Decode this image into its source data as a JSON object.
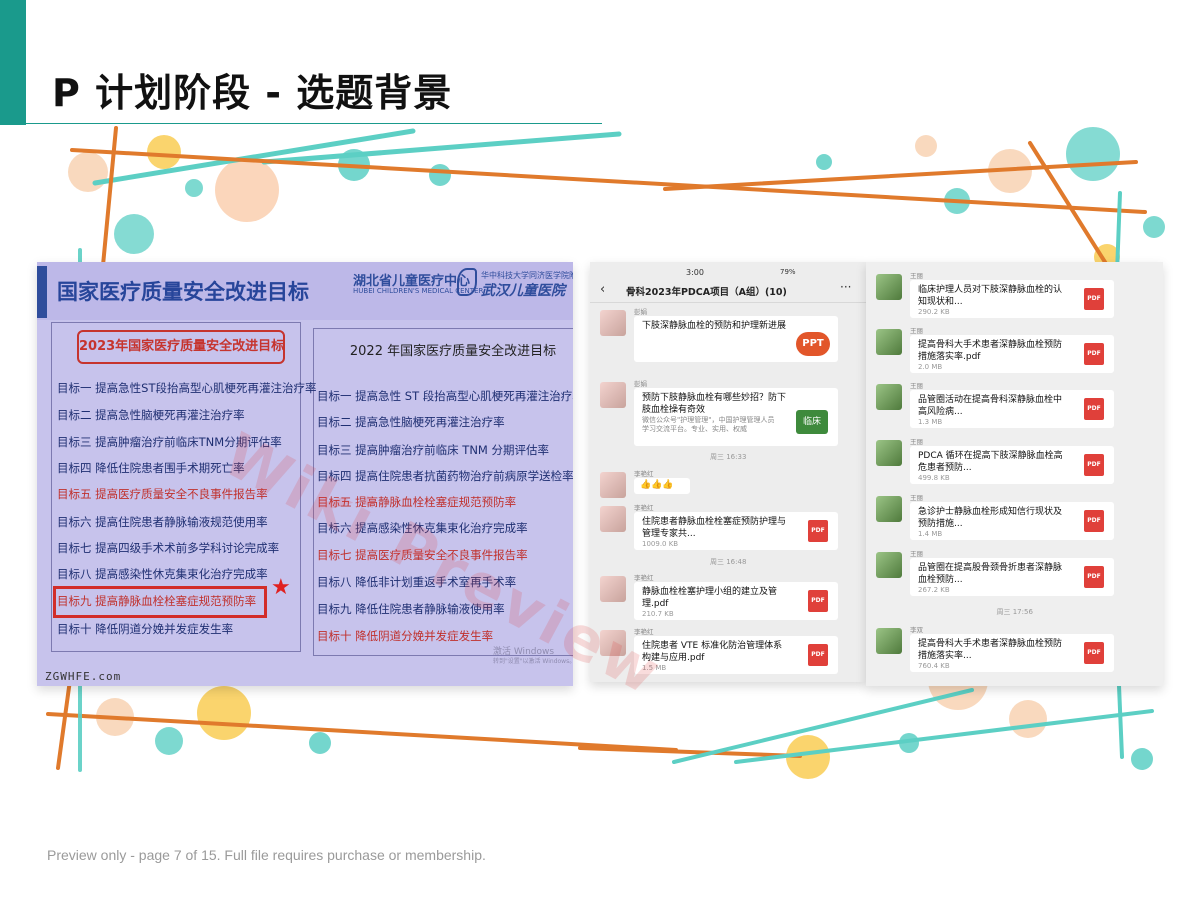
{
  "slide": {
    "title": "P  计划阶段 - 选题背景",
    "footer": "Preview only - page 7 of 15. Full file requires purchase or membership.",
    "watermark": "Wiki Preview"
  },
  "colors": {
    "teal": "#1a9a8c",
    "orange": "#e07a2c",
    "accent_red": "#d22d2a"
  },
  "photo": {
    "title": "国家医疗质量安全改进目标",
    "logo_cn": "湖北省儿童医疗中心",
    "logo_en": "HUBEI CHILDREN'S MEDICAL CENTER",
    "logo_mark_small": "华中科技大学同济医学院附属",
    "logo_hospital": "武汉儿童医院",
    "left_heading": "2023年国家医疗质量安全改进目标",
    "right_heading": "2022 年国家医疗质量安全改进目标",
    "left_goals": [
      {
        "text": "目标一  提高急性ST段抬高型心肌梗死再灌注治疗率"
      },
      {
        "text": "目标二  提高急性脑梗死再灌注治疗率"
      },
      {
        "text": "目标三  提高肿瘤治疗前临床TNM分期评估率"
      },
      {
        "text": "目标四  降低住院患者围手术期死亡率"
      },
      {
        "text": "目标五  提高医疗质量安全不良事件报告率"
      },
      {
        "text": "目标六  提高住院患者静脉输液规范使用率"
      },
      {
        "text": "目标七  提高四级手术术前多学科讨论完成率"
      },
      {
        "text": "目标八  提高感染性休克集束化治疗完成率"
      },
      {
        "text": "目标九  提高静脉血栓栓塞症规范预防率"
      },
      {
        "text": "目标十  降低阴道分娩并发症发生率"
      }
    ],
    "right_goals": [
      {
        "text": "目标一  提高急性 ST 段抬高型心肌梗死再灌注治疗率"
      },
      {
        "text": "目标二  提高急性脑梗死再灌注治疗率"
      },
      {
        "text": "目标三  提高肿瘤治疗前临床 TNM 分期评估率"
      },
      {
        "text": "目标四  提高住院患者抗菌药物治疗前病原学送检率"
      },
      {
        "text": "目标五  提高静脉血栓栓塞症规范预防率"
      },
      {
        "text": "目标六  提高感染性休克集束化治疗完成率"
      },
      {
        "text": "目标七  提高医疗质量安全不良事件报告率"
      },
      {
        "text": "目标八  降低非计划重返手术室再手术率"
      },
      {
        "text": "目标九  降低住院患者静脉输液使用率"
      },
      {
        "text": "目标十  降低阴道分娩并发症发生率"
      }
    ],
    "activate_windows": "激活 Windows",
    "activate_windows_sub": "转到\"设置\"以激活 Windows。",
    "site": "ZGWHFE.com"
  },
  "chat_mid": {
    "status_time": "3:00",
    "status_icons": "79%",
    "group_title": "骨科2023年PDCA项目（A组）(10)",
    "messages": [
      {
        "sender": "彭娟",
        "title": "下肢深静脉血栓的预防和护理新进展",
        "badge": "PPT"
      },
      {
        "sender": "彭娟",
        "title": "预防下肢静脉血栓有哪些妙招？防下肢血栓操有奇效",
        "sub": "微信公众号\"护理管理\"，中国护理管理人员学习交流平台。专业、实用、权威",
        "badge": "临床"
      },
      {
        "time": "周三 16:33"
      },
      {
        "sender": "李艳红",
        "emoji": "👍👍👍"
      },
      {
        "sender": "李艳红",
        "title": "住院患者静脉血栓栓塞症预防护理与管理专家共...",
        "size": "1009.0 KB",
        "badge": "PDF"
      },
      {
        "time": "周三 16:48"
      },
      {
        "sender": "李艳红",
        "title": "静脉血栓栓塞护理小组的建立及管理.pdf",
        "size": "210.7 KB",
        "badge": "PDF"
      },
      {
        "sender": "李艳红",
        "title": "住院患者 VTE 标准化防治管理体系构建与应用.pdf",
        "size": "1.5 MB",
        "badge": "PDF"
      }
    ]
  },
  "chat_right": {
    "messages": [
      {
        "sender": "王丽",
        "title": "临床护理人员对下肢深静脉血栓的认知现状和...",
        "size": "290.2 KB",
        "badge": "PDF"
      },
      {
        "sender": "王丽",
        "title": "提高骨科大手术患者深静脉血栓预防措施落实率.pdf",
        "size": "2.0 MB",
        "badge": "PDF"
      },
      {
        "sender": "王丽",
        "title": "品管圈活动在提高骨科深静脉血栓中高风险病...",
        "size": "1.3 MB",
        "badge": "PDF"
      },
      {
        "sender": "王丽",
        "title": "PDCA 循环在提高下肢深静脉血栓高危患者预防...",
        "size": "499.8 KB",
        "badge": "PDF"
      },
      {
        "sender": "王丽",
        "title": "急诊护士静脉血栓形成知信行现状及预防措施...",
        "size": "1.4 MB",
        "badge": "PDF"
      },
      {
        "sender": "王丽",
        "title": "品管圈在提高股骨颈骨折患者深静脉血栓预防...",
        "size": "267.2 KB",
        "badge": "PDF"
      },
      {
        "time": "周三 17:56"
      },
      {
        "sender": "李双",
        "title": "提高骨科大手术患者深静脉血栓预防措施落实率...",
        "size": "760.4 KB",
        "badge": "PDF"
      }
    ]
  }
}
